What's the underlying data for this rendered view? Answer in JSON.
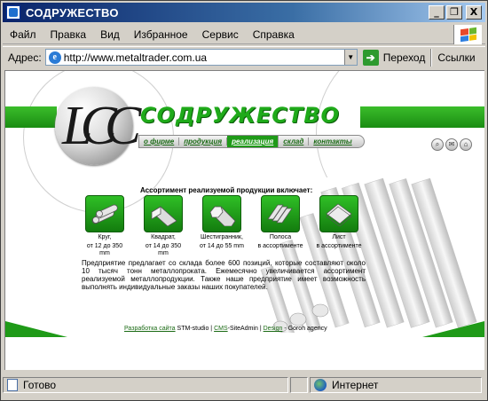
{
  "window": {
    "title": "СОДРУЖЕСТВО",
    "minimize": "_",
    "maximize": "❐",
    "close": "X"
  },
  "menu": [
    "Файл",
    "Правка",
    "Вид",
    "Избранное",
    "Сервис",
    "Справка"
  ],
  "address": {
    "label": "Адрес:",
    "url": "http://www.metaltrader.com.ua",
    "go_label": "Переход",
    "links_label": "Ссылки"
  },
  "page": {
    "site_title": "СОДРУЖЕСТВО",
    "logo_letters": "LCC",
    "nav": [
      {
        "label": "о фирме",
        "active": false
      },
      {
        "label": "продукция",
        "active": false
      },
      {
        "label": "реализация",
        "active": true
      },
      {
        "label": "склад",
        "active": false
      },
      {
        "label": "контакты",
        "active": false
      }
    ],
    "icons": [
      "search-icon",
      "mail-icon",
      "home-icon"
    ],
    "assortment_title": "Ассортимент реализуемой продукции включает:",
    "products": [
      {
        "name": "Круг,",
        "range": "от 12 до 350 mm",
        "icon": "round-bar-icon"
      },
      {
        "name": "Квадрат,",
        "range": "от 14 до 350 mm",
        "icon": "square-bar-icon"
      },
      {
        "name": "Шестигранник,",
        "range": "от 14 до 55 mm",
        "icon": "hexagon-bar-icon"
      },
      {
        "name": "Полоса",
        "range": "в ассортименте",
        "icon": "strip-icon"
      },
      {
        "name": "Лист",
        "range": "в ассортименте",
        "icon": "sheet-icon"
      }
    ],
    "description": "Предприятие предлагает со склада более 600 позиций, которые составляют около 10 тысяч тонн металлопроката. Ежемесячно увеличивается ассортимент реализуемой металлопродукции. Также наше предприятие имеет возможность выполнять индивидуальные заказы наших покупателей.",
    "credits": {
      "dev_link": "Разработка сайта",
      "dev_name": "STM-studio",
      "cms_link": "CMS",
      "cms_name": "-SiteAdmin",
      "design_link": "Design",
      "design_name": "- Goroh agency",
      "sep": "|"
    }
  },
  "status": {
    "text": "Готово",
    "zone": "Интернет"
  },
  "colors": {
    "brand_green": "#1f9a18",
    "title_bar": "#0a246a"
  }
}
